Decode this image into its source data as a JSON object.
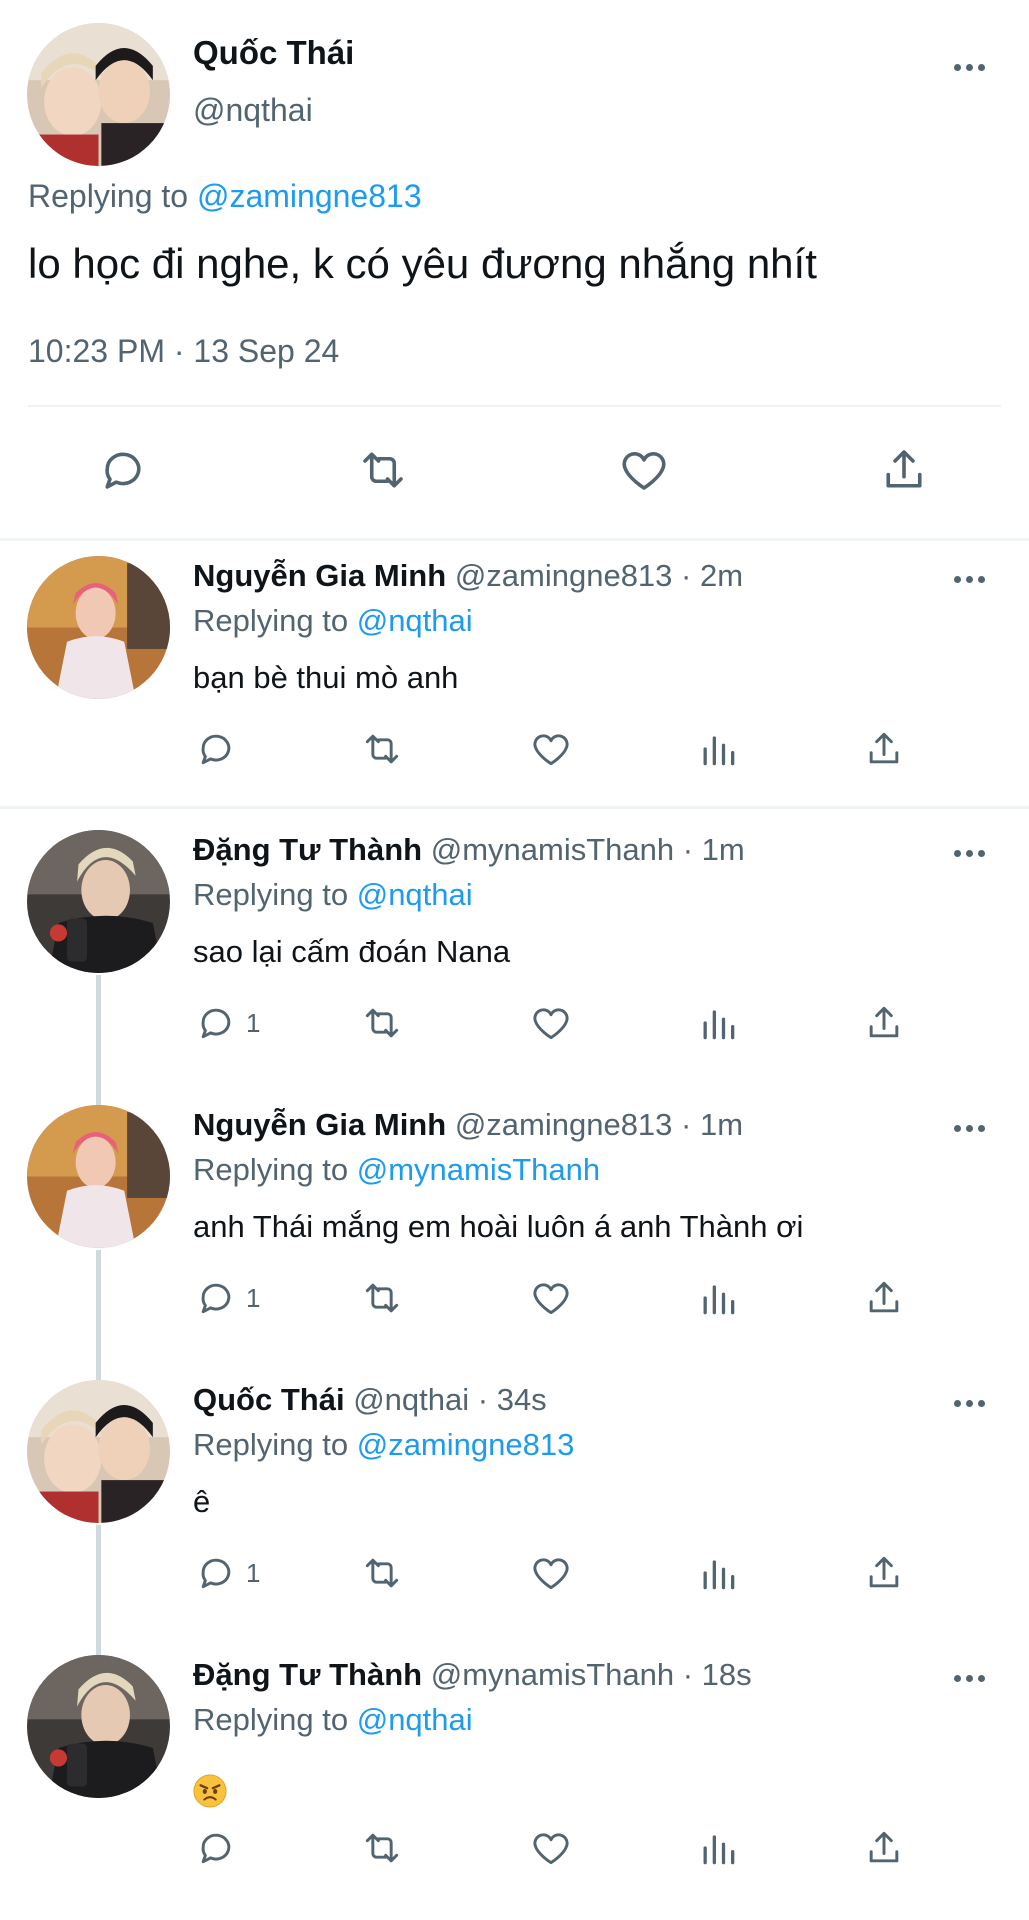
{
  "main_tweet": {
    "author_name": "Quốc Thái",
    "author_handle": "@nqthai",
    "replying_prefix": "Replying to",
    "replying_to": "@zamingne813",
    "text": "lo học đi nghe, k có yêu đương nhắng nhít",
    "timestamp": "10:23 PM · 13 Sep 24"
  },
  "replies": [
    {
      "name": "Nguyễn Gia Minh",
      "handle": "@zamingne813",
      "time": "· 2m",
      "replying_prefix": "Replying to",
      "replying_to": "@nqthai",
      "text": "bạn bè thui mò anh",
      "reply_count": ""
    },
    {
      "name": "Đặng Tư Thành",
      "handle": "@mynamisThanh",
      "time": "· 1m",
      "replying_prefix": "Replying to",
      "replying_to": "@nqthai",
      "text": "sao lại cấm đoán Nana",
      "reply_count": "1"
    },
    {
      "name": "Nguyễn Gia Minh",
      "handle": "@zamingne813",
      "time": "· 1m",
      "replying_prefix": "Replying to",
      "replying_to": "@mynamisThanh",
      "text": "anh Thái mắng em hoài luôn á anh Thành ơi",
      "reply_count": "1"
    },
    {
      "name": "Quốc Thái",
      "handle": "@nqthai",
      "time": "· 34s",
      "replying_prefix": "Replying to",
      "replying_to": "@zamingne813",
      "text": "ê",
      "reply_count": "1"
    },
    {
      "name": "Đặng Tư Thành",
      "handle": "@mynamisThanh",
      "time": "· 18s",
      "replying_prefix": "Replying to",
      "replying_to": "@nqthai",
      "text": "",
      "emoji": "angry-face-emoji",
      "reply_count": ""
    }
  ],
  "icons": {
    "more": "more-horizontal-icon",
    "reply": "reply-bubble-icon",
    "retweet": "retweet-icon",
    "like": "heart-icon",
    "views": "analytics-bars-icon",
    "share": "share-upload-icon"
  },
  "colors": {
    "link": "#1d9bf0",
    "secondary_text": "#536471",
    "primary_text": "#0f1419",
    "divider": "#eff3f4",
    "thread_line": "#cfd9de"
  }
}
